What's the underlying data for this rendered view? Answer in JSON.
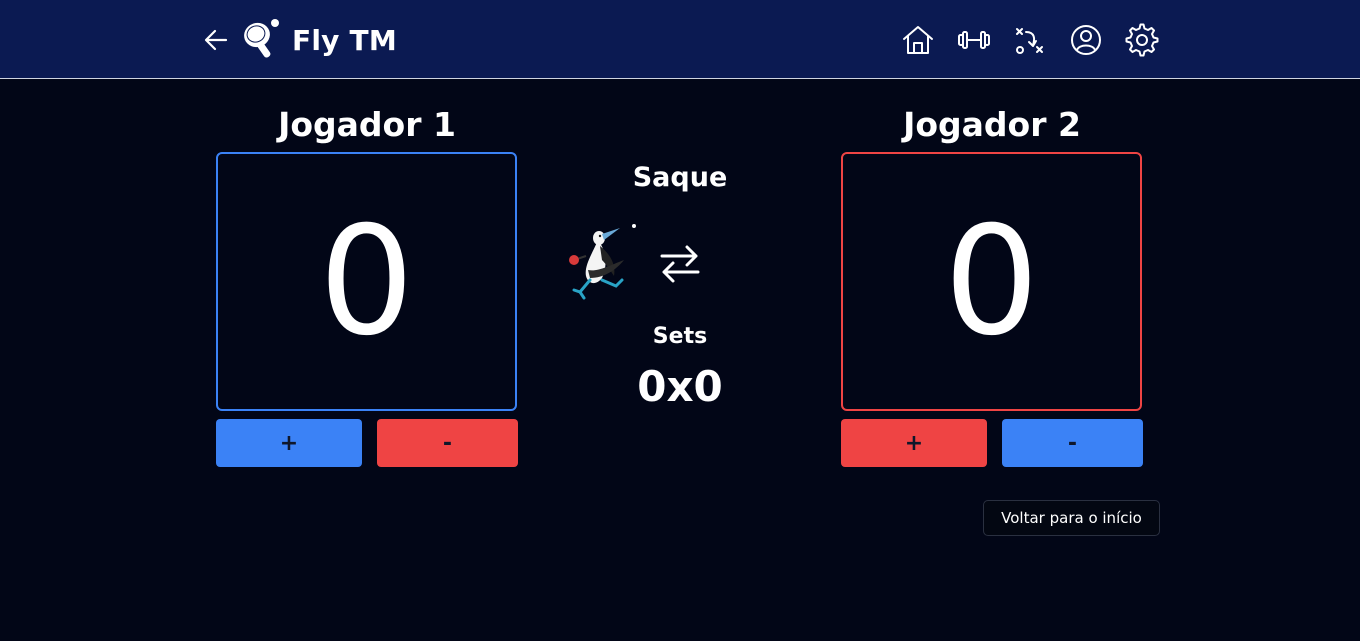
{
  "header": {
    "title": "Fly TM",
    "back_icon": "arrow-left-icon",
    "logo": "ping-pong-paddle-logo",
    "nav_icons": [
      "home-icon",
      "dumbbell-icon",
      "tactics-icon",
      "user-icon",
      "gear-icon"
    ]
  },
  "player1": {
    "name": "Jogador 1",
    "score": "0",
    "plus_label": "+",
    "minus_label": "-",
    "accent": "#3b82f6"
  },
  "player2": {
    "name": "Jogador 2",
    "score": "0",
    "plus_label": "+",
    "minus_label": "-",
    "accent": "#ef4444"
  },
  "center": {
    "serve_label": "Saque",
    "sets_label": "Sets",
    "sets_value": "0x0",
    "swap_icon": "swap-arrows-icon",
    "mascot": "bird-ping-pong-mascot"
  },
  "footer": {
    "home_button": "Voltar para o início"
  },
  "colors": {
    "background": "#020617",
    "navbar": "#0b1a52",
    "blue": "#3b82f6",
    "red": "#ef4444"
  }
}
